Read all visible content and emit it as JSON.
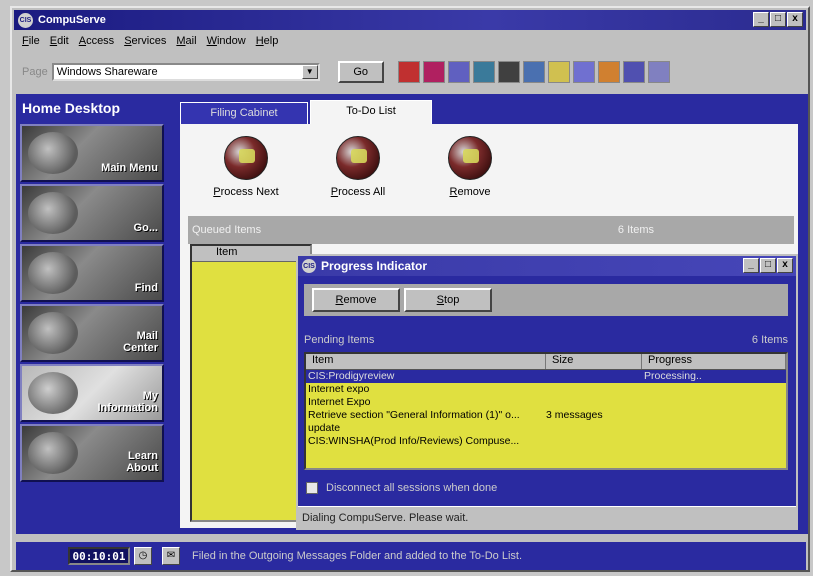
{
  "app": {
    "title": "CompuServe"
  },
  "window_buttons": [
    "_",
    "□",
    "x"
  ],
  "menu": [
    "File",
    "Edit",
    "Access",
    "Services",
    "Mail",
    "Window",
    "Help"
  ],
  "toolbar": {
    "go_label": "Page",
    "go_value": "Windows Shareware",
    "go_button": "Go",
    "icon_count": 11
  },
  "sidebar": {
    "title": "Home Desktop",
    "items": [
      {
        "label": "Main Menu"
      },
      {
        "label": "Go..."
      },
      {
        "label": "Find"
      },
      {
        "label": "Mail Center"
      },
      {
        "label": "My Information"
      },
      {
        "label": "Learn About"
      }
    ]
  },
  "tabs": [
    {
      "label": "Filing Cabinet",
      "active": false
    },
    {
      "label": "To-Do List",
      "active": true
    }
  ],
  "actions": [
    {
      "label": "Process Next"
    },
    {
      "label": "Process All"
    },
    {
      "label": "Remove"
    }
  ],
  "queued": {
    "label": "Queued Items",
    "count": "6 Items",
    "column": "Item"
  },
  "dialog": {
    "title": "Progress Indicator",
    "buttons": {
      "remove": "Remove",
      "stop": "Stop"
    },
    "pending_label": "Pending Items",
    "pending_count": "6 Items",
    "columns": [
      "Item",
      "Size",
      "Progress"
    ],
    "rows": [
      {
        "item": "CIS:Prodigyreview",
        "size": "",
        "progress": "Processing..",
        "selected": true
      },
      {
        "item": "Internet expo",
        "size": "",
        "progress": "",
        "selected": false
      },
      {
        "item": "Internet Expo",
        "size": "",
        "progress": "",
        "selected": false
      },
      {
        "item": "Retrieve section \"General Information (1)\" o...",
        "size": "3 messages",
        "progress": "",
        "selected": false
      },
      {
        "item": "update",
        "size": "",
        "progress": "",
        "selected": false
      },
      {
        "item": "CIS:WINSHA(Prod Info/Reviews) Compuse...",
        "size": "",
        "progress": "",
        "selected": false
      }
    ],
    "disconnect_label": "Disconnect all sessions when done",
    "status": "Dialing CompuServe. Please wait."
  },
  "statusbar": {
    "clock": "00:10:01",
    "message": "Filed in the Outgoing Messages Folder and added to the To-Do List."
  }
}
